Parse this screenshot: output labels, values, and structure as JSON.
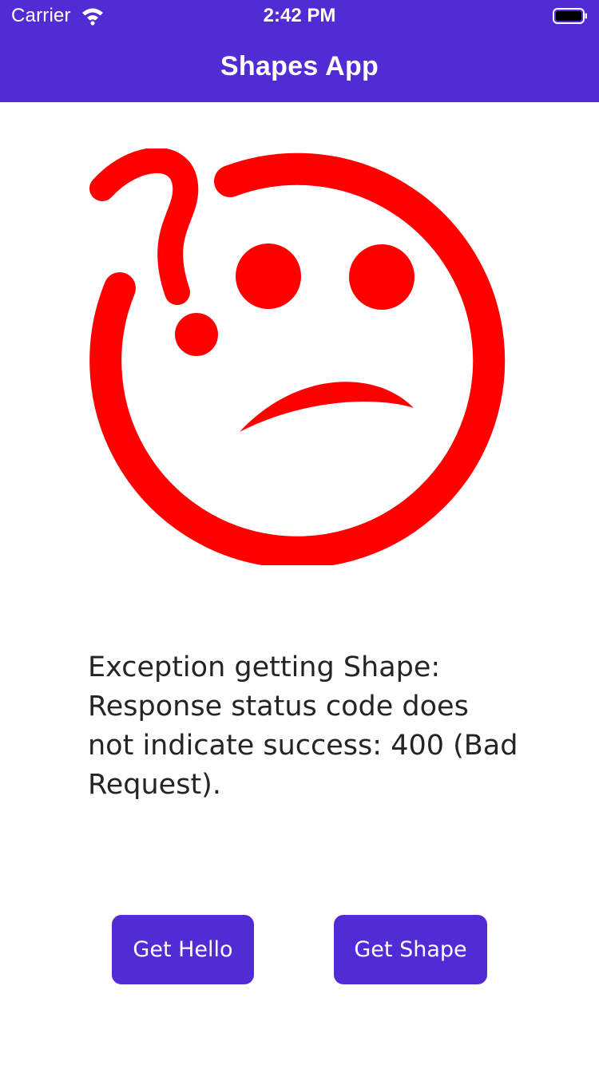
{
  "status_bar": {
    "carrier": "Carrier",
    "time": "2:42 PM"
  },
  "nav": {
    "title": "Shapes App"
  },
  "image": {
    "icon": "confused-sad-face-icon",
    "color": "#ff0000"
  },
  "message": {
    "text": "Exception getting Shape: Response status code does not indicate success: 400 (Bad Request)."
  },
  "buttons": {
    "get_hello": "Get Hello",
    "get_shape": "Get Shape"
  },
  "colors": {
    "primary": "#512bd4",
    "text": "#242424",
    "background": "#ffffff"
  }
}
